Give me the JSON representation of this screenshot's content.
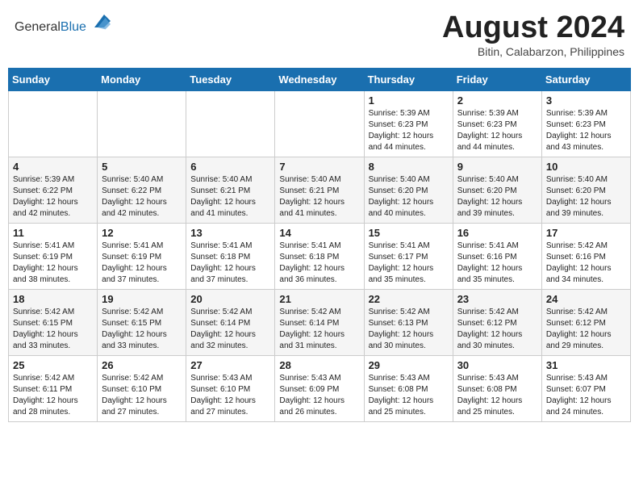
{
  "header": {
    "logo_general": "General",
    "logo_blue": "Blue",
    "month_title": "August 2024",
    "location": "Bitin, Calabarzon, Philippines"
  },
  "weekdays": [
    "Sunday",
    "Monday",
    "Tuesday",
    "Wednesday",
    "Thursday",
    "Friday",
    "Saturday"
  ],
  "weeks": [
    [
      {
        "day": "",
        "info": ""
      },
      {
        "day": "",
        "info": ""
      },
      {
        "day": "",
        "info": ""
      },
      {
        "day": "",
        "info": ""
      },
      {
        "day": "1",
        "info": "Sunrise: 5:39 AM\nSunset: 6:23 PM\nDaylight: 12 hours\nand 44 minutes."
      },
      {
        "day": "2",
        "info": "Sunrise: 5:39 AM\nSunset: 6:23 PM\nDaylight: 12 hours\nand 44 minutes."
      },
      {
        "day": "3",
        "info": "Sunrise: 5:39 AM\nSunset: 6:23 PM\nDaylight: 12 hours\nand 43 minutes."
      }
    ],
    [
      {
        "day": "4",
        "info": "Sunrise: 5:39 AM\nSunset: 6:22 PM\nDaylight: 12 hours\nand 42 minutes."
      },
      {
        "day": "5",
        "info": "Sunrise: 5:40 AM\nSunset: 6:22 PM\nDaylight: 12 hours\nand 42 minutes."
      },
      {
        "day": "6",
        "info": "Sunrise: 5:40 AM\nSunset: 6:21 PM\nDaylight: 12 hours\nand 41 minutes."
      },
      {
        "day": "7",
        "info": "Sunrise: 5:40 AM\nSunset: 6:21 PM\nDaylight: 12 hours\nand 41 minutes."
      },
      {
        "day": "8",
        "info": "Sunrise: 5:40 AM\nSunset: 6:20 PM\nDaylight: 12 hours\nand 40 minutes."
      },
      {
        "day": "9",
        "info": "Sunrise: 5:40 AM\nSunset: 6:20 PM\nDaylight: 12 hours\nand 39 minutes."
      },
      {
        "day": "10",
        "info": "Sunrise: 5:40 AM\nSunset: 6:20 PM\nDaylight: 12 hours\nand 39 minutes."
      }
    ],
    [
      {
        "day": "11",
        "info": "Sunrise: 5:41 AM\nSunset: 6:19 PM\nDaylight: 12 hours\nand 38 minutes."
      },
      {
        "day": "12",
        "info": "Sunrise: 5:41 AM\nSunset: 6:19 PM\nDaylight: 12 hours\nand 37 minutes."
      },
      {
        "day": "13",
        "info": "Sunrise: 5:41 AM\nSunset: 6:18 PM\nDaylight: 12 hours\nand 37 minutes."
      },
      {
        "day": "14",
        "info": "Sunrise: 5:41 AM\nSunset: 6:18 PM\nDaylight: 12 hours\nand 36 minutes."
      },
      {
        "day": "15",
        "info": "Sunrise: 5:41 AM\nSunset: 6:17 PM\nDaylight: 12 hours\nand 35 minutes."
      },
      {
        "day": "16",
        "info": "Sunrise: 5:41 AM\nSunset: 6:16 PM\nDaylight: 12 hours\nand 35 minutes."
      },
      {
        "day": "17",
        "info": "Sunrise: 5:42 AM\nSunset: 6:16 PM\nDaylight: 12 hours\nand 34 minutes."
      }
    ],
    [
      {
        "day": "18",
        "info": "Sunrise: 5:42 AM\nSunset: 6:15 PM\nDaylight: 12 hours\nand 33 minutes."
      },
      {
        "day": "19",
        "info": "Sunrise: 5:42 AM\nSunset: 6:15 PM\nDaylight: 12 hours\nand 33 minutes."
      },
      {
        "day": "20",
        "info": "Sunrise: 5:42 AM\nSunset: 6:14 PM\nDaylight: 12 hours\nand 32 minutes."
      },
      {
        "day": "21",
        "info": "Sunrise: 5:42 AM\nSunset: 6:14 PM\nDaylight: 12 hours\nand 31 minutes."
      },
      {
        "day": "22",
        "info": "Sunrise: 5:42 AM\nSunset: 6:13 PM\nDaylight: 12 hours\nand 30 minutes."
      },
      {
        "day": "23",
        "info": "Sunrise: 5:42 AM\nSunset: 6:12 PM\nDaylight: 12 hours\nand 30 minutes."
      },
      {
        "day": "24",
        "info": "Sunrise: 5:42 AM\nSunset: 6:12 PM\nDaylight: 12 hours\nand 29 minutes."
      }
    ],
    [
      {
        "day": "25",
        "info": "Sunrise: 5:42 AM\nSunset: 6:11 PM\nDaylight: 12 hours\nand 28 minutes."
      },
      {
        "day": "26",
        "info": "Sunrise: 5:42 AM\nSunset: 6:10 PM\nDaylight: 12 hours\nand 27 minutes."
      },
      {
        "day": "27",
        "info": "Sunrise: 5:43 AM\nSunset: 6:10 PM\nDaylight: 12 hours\nand 27 minutes."
      },
      {
        "day": "28",
        "info": "Sunrise: 5:43 AM\nSunset: 6:09 PM\nDaylight: 12 hours\nand 26 minutes."
      },
      {
        "day": "29",
        "info": "Sunrise: 5:43 AM\nSunset: 6:08 PM\nDaylight: 12 hours\nand 25 minutes."
      },
      {
        "day": "30",
        "info": "Sunrise: 5:43 AM\nSunset: 6:08 PM\nDaylight: 12 hours\nand 25 minutes."
      },
      {
        "day": "31",
        "info": "Sunrise: 5:43 AM\nSunset: 6:07 PM\nDaylight: 12 hours\nand 24 minutes."
      }
    ]
  ]
}
